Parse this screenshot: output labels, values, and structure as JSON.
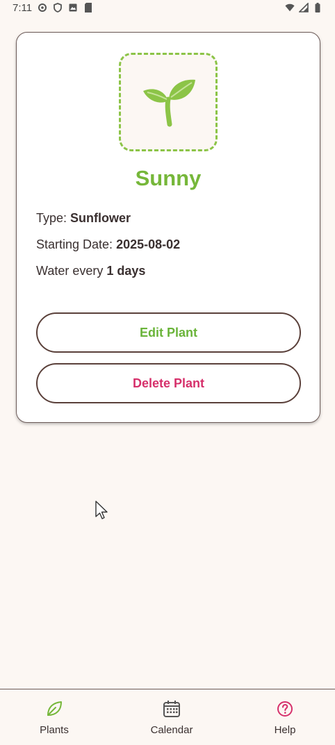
{
  "status_bar": {
    "time": "7:11"
  },
  "plant": {
    "name": "Sunny",
    "type_label": "Type:",
    "type_value": "Sunflower",
    "start_label": "Starting Date:",
    "start_value": "2025-08-02",
    "water_prefix": "Water every",
    "water_value": "1 days"
  },
  "actions": {
    "edit_label": "Edit Plant",
    "delete_label": "Delete Plant"
  },
  "nav": {
    "items": [
      {
        "label": "Plants",
        "icon": "leaf-icon",
        "active": true
      },
      {
        "label": "Calendar",
        "icon": "calendar-icon",
        "active": false
      },
      {
        "label": "Help",
        "icon": "help-icon",
        "active": false
      }
    ]
  },
  "colors": {
    "accent_green": "#76b73a",
    "delete_pink": "#d6306b",
    "help_pink": "#d6306b",
    "background": "#fcf7f3",
    "border_brown": "#5a403a"
  }
}
